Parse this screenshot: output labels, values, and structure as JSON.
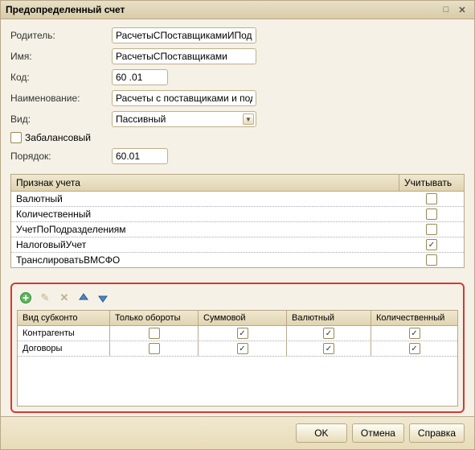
{
  "window": {
    "title": "Предопределенный счет"
  },
  "form": {
    "parent_label": "Родитель:",
    "parent_value": "РасчетыСПоставщикамиИПодрядчик",
    "name_label": "Имя:",
    "name_value": "РасчетыСПоставщиками",
    "code_label": "Код:",
    "code_value": "60 .01",
    "title_label": "Наименование:",
    "title_value": "Расчеты с поставщиками и подрядчи",
    "kind_label": "Вид:",
    "kind_value": "Пассивный",
    "offbalance_label": "Забалансовый",
    "offbalance_checked": false,
    "order_label": "Порядок:",
    "order_value": "60.01"
  },
  "account_table": {
    "col_sign": "Признак учета",
    "col_use": "Учитывать",
    "rows": [
      {
        "label": "Валютный",
        "checked": false
      },
      {
        "label": "Количественный",
        "checked": false
      },
      {
        "label": "УчетПоПодразделениям",
        "checked": false
      },
      {
        "label": "НалоговыйУчет",
        "checked": true
      },
      {
        "label": "ТранслироватьВМСФО",
        "checked": false
      }
    ]
  },
  "sub_table": {
    "cols": {
      "kind": "Вид субконто",
      "turnover": "Только обороты",
      "sum": "Суммовой",
      "currency": "Валютный",
      "qty": "Количественный"
    },
    "rows": [
      {
        "kind": "Контрагенты",
        "turnover": false,
        "sum": true,
        "currency": true,
        "qty": true
      },
      {
        "kind": "Договоры",
        "turnover": false,
        "sum": true,
        "currency": true,
        "qty": true
      }
    ]
  },
  "footer": {
    "ok": "OK",
    "cancel": "Отмена",
    "help": "Справка"
  }
}
